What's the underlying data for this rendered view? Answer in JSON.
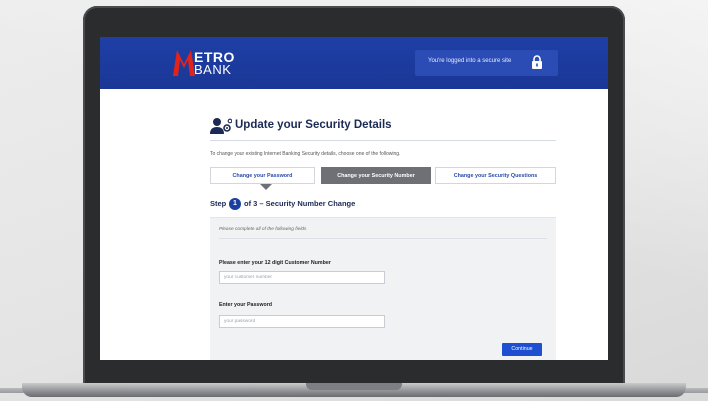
{
  "brand": {
    "logo_line1": "ETRO",
    "logo_line2": "BANK",
    "logo_mark": "M",
    "primary_color": "#1f3fa6",
    "accent_red": "#e2231a"
  },
  "header": {
    "secure_text": "You're logged into a secure site",
    "secure_icon": "lock-icon"
  },
  "page": {
    "title": "Update your Security Details",
    "title_icon": "user-gear-icon",
    "intro": "To change your existing Internet Banking Security details, choose one of the following."
  },
  "tabs": [
    {
      "label": "Change your Password",
      "active": false
    },
    {
      "label": "Change your Security Number",
      "active": true
    },
    {
      "label": "Change your Security Questions",
      "active": false
    }
  ],
  "step": {
    "prefix": "Step",
    "number": "1",
    "suffix": "of 3 – Security Number Change"
  },
  "form": {
    "note": "Please complete all of the following fields",
    "customer_label": "Please enter your 12 digit Customer Number",
    "customer_placeholder": "your customer number",
    "password_label": "Enter your Password",
    "password_placeholder": "your password",
    "continue_label": "Continue"
  }
}
